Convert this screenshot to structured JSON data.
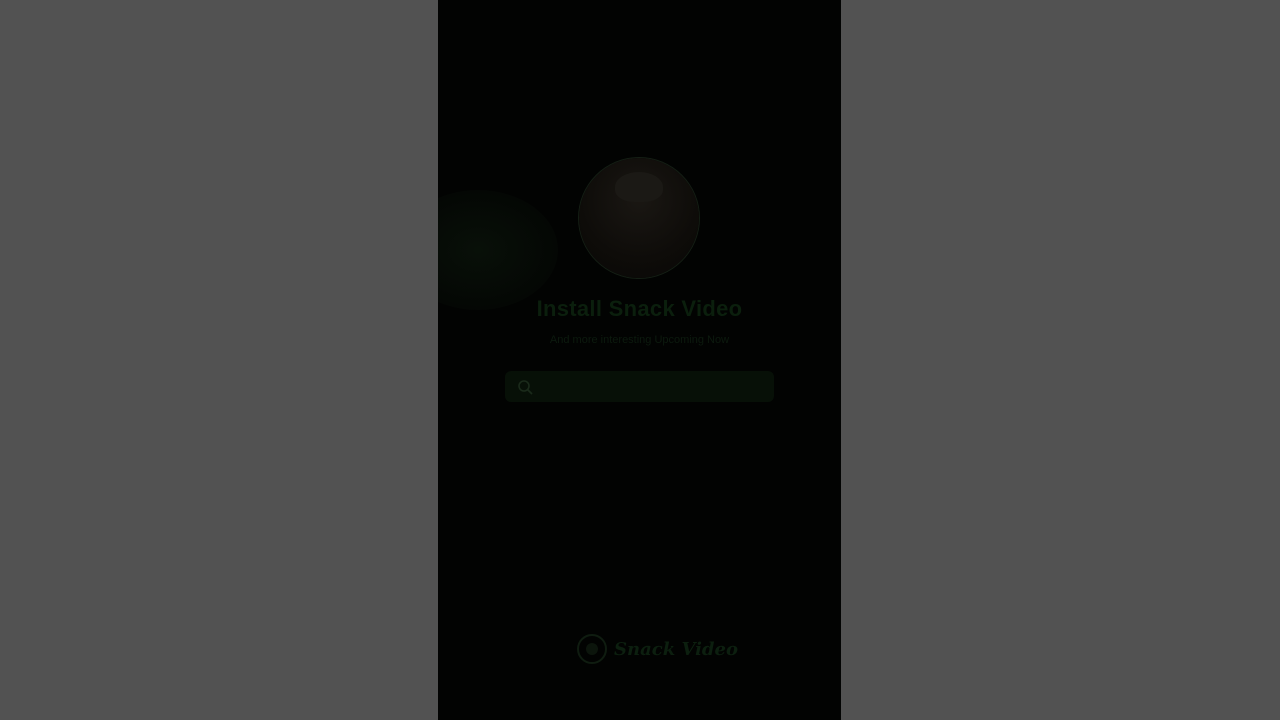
{
  "page": {
    "title": "Install Snack Video",
    "subtitle": "And more interesting Upcoming Now",
    "search": {
      "placeholder": "",
      "value": ""
    },
    "brand": {
      "name": "Snack Video"
    }
  },
  "icons": {
    "search": "search-icon",
    "logo": "snack-video-logo-icon"
  },
  "colors": {
    "backdrop": "#515151",
    "phone_background": "#020302",
    "accent_green": "#0b1f0d"
  }
}
